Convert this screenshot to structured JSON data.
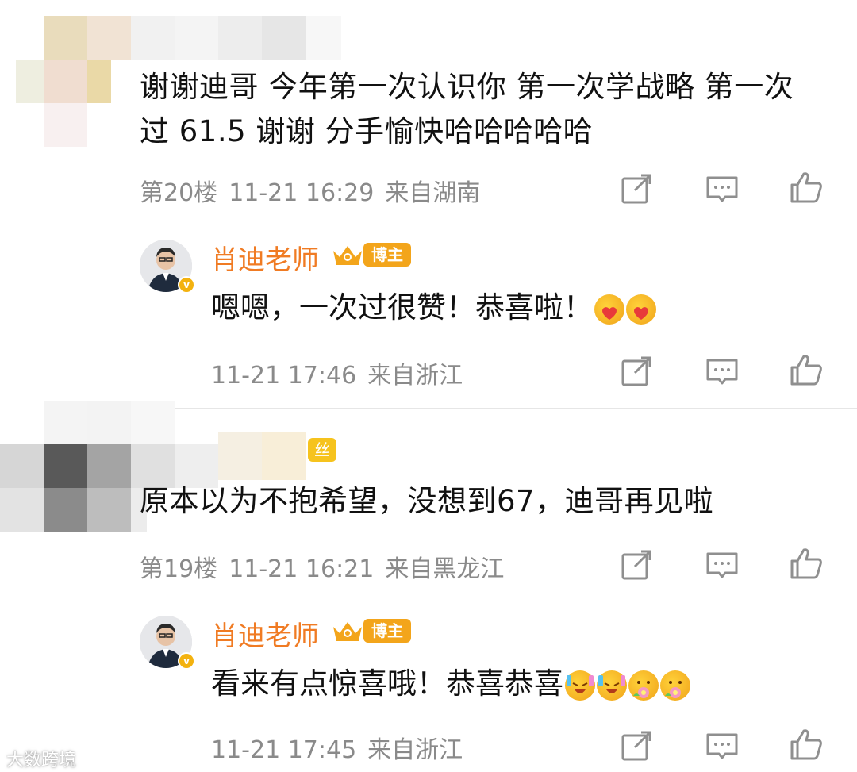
{
  "comments": [
    {
      "text": "谢谢迪哥 今年第一次认识你 第一次学战略 第一次过 61.5 谢谢 分手愉快哈哈哈哈哈",
      "floor": "第20楼",
      "time": "11-21 16:29",
      "location": "来自湖南",
      "reply": {
        "author": "肖迪老师",
        "badge": "博主",
        "text": "嗯嗯，一次过很赞！恭喜啦！",
        "time": "11-21 17:46",
        "location": "来自浙江"
      }
    },
    {
      "fan_badge": "丝",
      "text": "原本以为不抱希望，没想到67，迪哥再见啦",
      "floor": "第19楼",
      "time": "11-21 16:21",
      "location": "来自黑龙江",
      "reply": {
        "author": "肖迪老师",
        "badge": "博主",
        "text": "看来有点惊喜哦！恭喜恭喜",
        "time": "11-21 17:45",
        "location": "来自浙江"
      }
    }
  ],
  "watermark": "大数跨境",
  "colors": {
    "author": "#f07b23",
    "meta": "#8a8a8a",
    "badge": "#f3a51b",
    "icon": "#8f8f8f"
  },
  "icons": [
    "share-icon",
    "comment-icon",
    "like-icon",
    "crown-icon",
    "verified-icon"
  ]
}
